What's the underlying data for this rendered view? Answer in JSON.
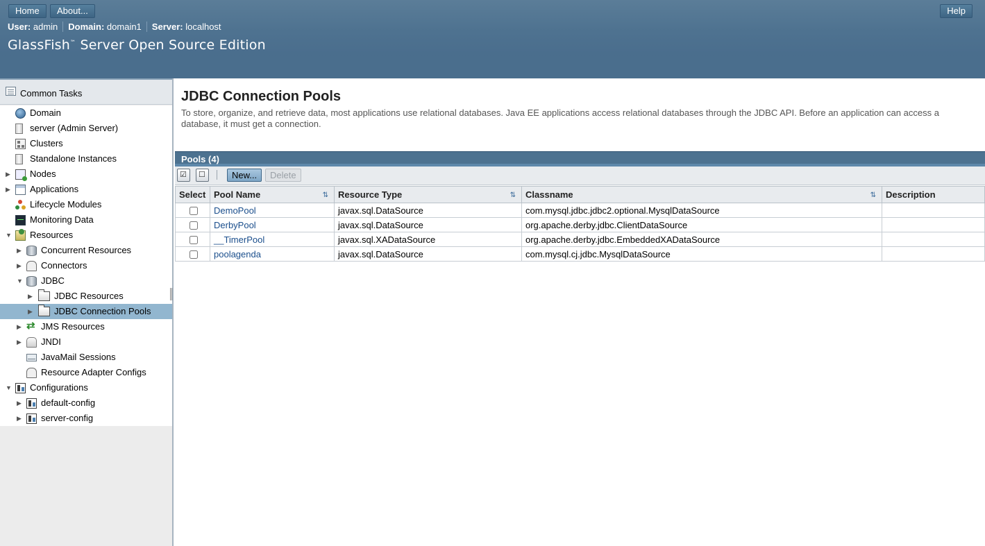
{
  "masthead": {
    "home_label": "Home",
    "about_label": "About...",
    "help_label": "Help",
    "user_key": "User:",
    "user_value": "admin",
    "domain_key": "Domain:",
    "domain_value": "domain1",
    "server_key": "Server:",
    "server_value": "localhost",
    "product_name": "GlassFish",
    "product_tm": "™",
    "product_suffix": " Server Open Source Edition"
  },
  "sidebar": {
    "common_tasks": "Common Tasks",
    "items": [
      {
        "label": "Domain",
        "icon": "globe-icon"
      },
      {
        "label": "server (Admin Server)",
        "icon": "server-icon"
      },
      {
        "label": "Clusters",
        "icon": "cluster-icon"
      },
      {
        "label": "Standalone Instances",
        "icon": "server-icon"
      },
      {
        "label": "Nodes",
        "icon": "nodes-icon",
        "expander": "▶"
      },
      {
        "label": "Applications",
        "icon": "applications-icon",
        "expander": "▶"
      },
      {
        "label": "Lifecycle Modules",
        "icon": "lifecycle-icon"
      },
      {
        "label": "Monitoring Data",
        "icon": "monitor-icon"
      },
      {
        "label": "Resources",
        "icon": "resources-icon",
        "expander": "▼"
      },
      {
        "label": "Concurrent Resources",
        "icon": "database-icon",
        "expander": "▶"
      },
      {
        "label": "Connectors",
        "icon": "connector-icon",
        "expander": "▶"
      },
      {
        "label": "JDBC",
        "icon": "database-icon",
        "expander": "▼"
      },
      {
        "label": "JDBC Resources",
        "icon": "folder-icon",
        "expander": "▶"
      },
      {
        "label": "JDBC Connection Pools",
        "icon": "folder-icon",
        "expander": "▶"
      },
      {
        "label": "JMS Resources",
        "icon": "jms-icon",
        "expander": "▶"
      },
      {
        "label": "JNDI",
        "icon": "jndi-icon",
        "expander": "▶"
      },
      {
        "label": "JavaMail Sessions",
        "icon": "mail-icon"
      },
      {
        "label": "Resource Adapter Configs",
        "icon": "connector-icon"
      },
      {
        "label": "Configurations",
        "icon": "config-icon",
        "expander": "▼"
      },
      {
        "label": "default-config",
        "icon": "config-icon",
        "expander": "▶"
      },
      {
        "label": "server-config",
        "icon": "config-icon",
        "expander": "▶"
      }
    ]
  },
  "main": {
    "title": "JDBC Connection Pools",
    "help_text": "To store, organize, and retrieve data, most applications use relational databases. Java EE applications access relational databases through the JDBC API. Before an application can access a database, it must get a connection.",
    "table_title": "Pools (4)",
    "new_label": "New...",
    "delete_label": "Delete",
    "columns": [
      "Select",
      "Pool Name",
      "Resource Type",
      "Classname",
      "Description"
    ],
    "rows": [
      {
        "name": "DemoPool",
        "type": "javax.sql.DataSource",
        "classname": "com.mysql.jdbc.jdbc2.optional.MysqlDataSource",
        "description": ""
      },
      {
        "name": "DerbyPool",
        "type": "javax.sql.DataSource",
        "classname": "org.apache.derby.jdbc.ClientDataSource",
        "description": ""
      },
      {
        "name": "__TimerPool",
        "type": "javax.sql.XADataSource",
        "classname": "org.apache.derby.jdbc.EmbeddedXADataSource",
        "description": ""
      },
      {
        "name": "poolagenda",
        "type": "javax.sql.DataSource",
        "classname": "com.mysql.cj.jdbc.MysqlDataSource",
        "description": ""
      }
    ]
  }
}
